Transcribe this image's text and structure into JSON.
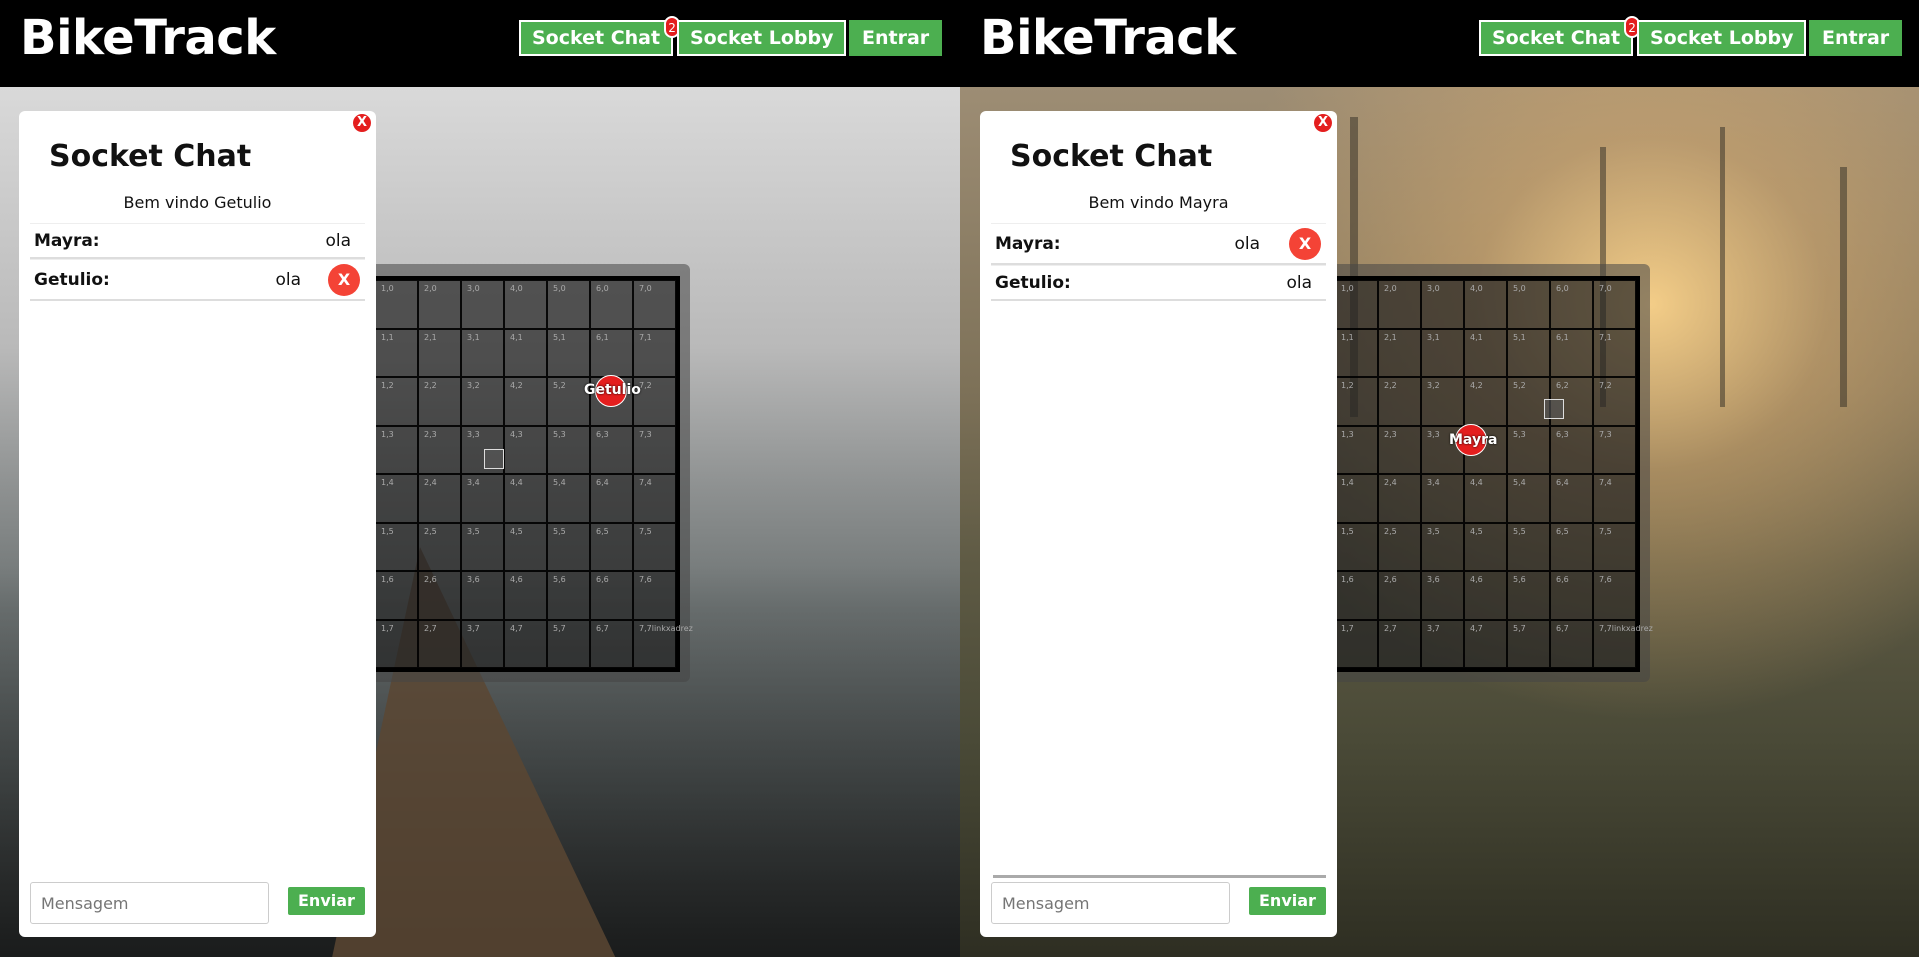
{
  "left_window": {
    "logo": "BikeTrack",
    "nav": {
      "chat_label": "Socket Chat",
      "chat_badge": "2",
      "lobby_label": "Socket Lobby",
      "login_label": "Entrar"
    },
    "chat": {
      "title": "Socket Chat",
      "close_label": "X",
      "welcome": "Bem vindo Getulio",
      "messages": [
        {
          "user": "Mayra:",
          "text": "ola",
          "deletable": false
        },
        {
          "user": "Getulio:",
          "text": "ola",
          "deletable": true,
          "delete_label": "X"
        }
      ],
      "input_placeholder": "Mensagem",
      "send_label": "Enviar"
    },
    "board": {
      "player_name": "Getulio",
      "corner_tag": "linkxadrez"
    }
  },
  "right_window": {
    "logo": "BikeTrack",
    "nav": {
      "chat_label": "Socket Chat",
      "chat_badge": "2",
      "lobby_label": "Socket Lobby",
      "login_label": "Entrar"
    },
    "chat": {
      "title": "Socket Chat",
      "close_label": "X",
      "welcome": "Bem vindo Mayra",
      "messages": [
        {
          "user": "Mayra:",
          "text": "ola",
          "deletable": true,
          "delete_label": "X"
        },
        {
          "user": "Getulio:",
          "text": "ola",
          "deletable": false
        }
      ],
      "input_placeholder": "Mensagem",
      "send_label": "Enviar"
    },
    "board": {
      "player_name": "Mayra",
      "corner_tag": "linkxadrez"
    }
  },
  "grid_size": 8,
  "colors": {
    "accent": "#4caf50",
    "alert": "#e41e1e",
    "delete": "#f44336",
    "header": "#000000"
  }
}
